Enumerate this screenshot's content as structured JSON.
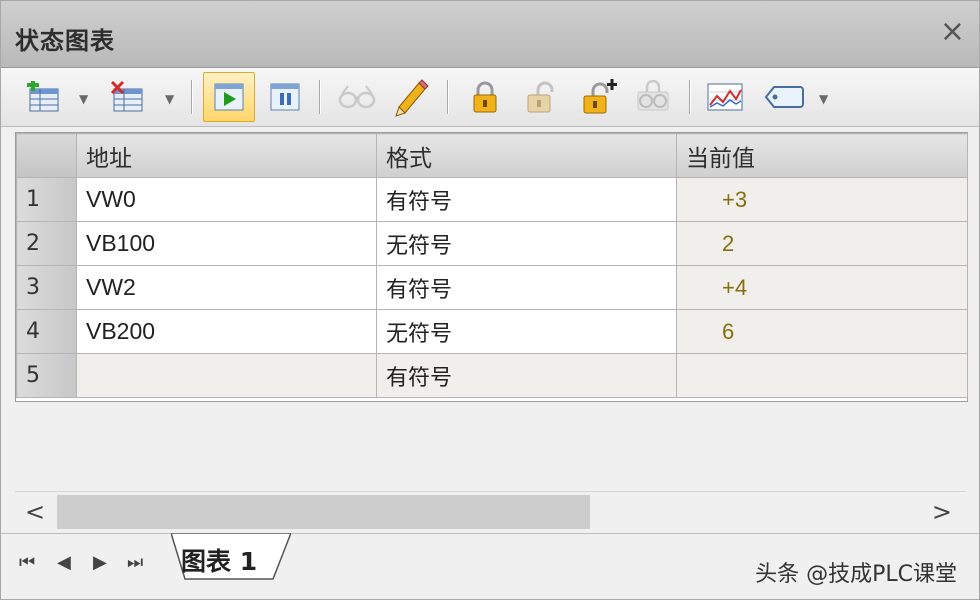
{
  "window": {
    "title": "状态图表",
    "close_glyph": "×"
  },
  "toolbar": {
    "buttons": [
      {
        "id": "insert-row",
        "icon": "table-add-icon"
      },
      {
        "id": "delete-row",
        "icon": "table-delete-icon"
      },
      {
        "id": "run-trend",
        "icon": "play-icon",
        "active": true
      },
      {
        "id": "pause",
        "icon": "pause-icon"
      },
      {
        "id": "read",
        "icon": "glasses-icon"
      },
      {
        "id": "write",
        "icon": "pencil-icon"
      },
      {
        "id": "force",
        "icon": "lock-icon"
      },
      {
        "id": "unforce",
        "icon": "unlock-icon"
      },
      {
        "id": "unforce-all",
        "icon": "unlock-all-icon"
      },
      {
        "id": "read-forced",
        "icon": "glasses-lock-icon"
      },
      {
        "id": "trend-view",
        "icon": "trend-chart-icon"
      },
      {
        "id": "tag",
        "icon": "tag-icon"
      }
    ]
  },
  "table": {
    "columns": [
      "地址",
      "格式",
      "当前值"
    ],
    "rows": [
      {
        "num": "1",
        "address": "VW0",
        "format": "有符号",
        "value": "+3"
      },
      {
        "num": "2",
        "address": "VB100",
        "format": "无符号",
        "value": "2"
      },
      {
        "num": "3",
        "address": "VW2",
        "format": "有符号",
        "value": "+4"
      },
      {
        "num": "4",
        "address": "VB200",
        "format": "无符号",
        "value": "6"
      },
      {
        "num": "5",
        "address": "",
        "format": "有符号",
        "value": ""
      }
    ]
  },
  "scrollbar": {
    "left_glyph": "<",
    "right_glyph": ">"
  },
  "tabs": {
    "nav_first": "⏮",
    "nav_prev": "◀",
    "nav_next": "▶",
    "nav_last": "⏭",
    "active_label": "图表 1"
  },
  "watermark": "头条 @技成PLC课堂",
  "colors": {
    "value_text": "#8a6d10",
    "active_button": "#ffd66b"
  }
}
